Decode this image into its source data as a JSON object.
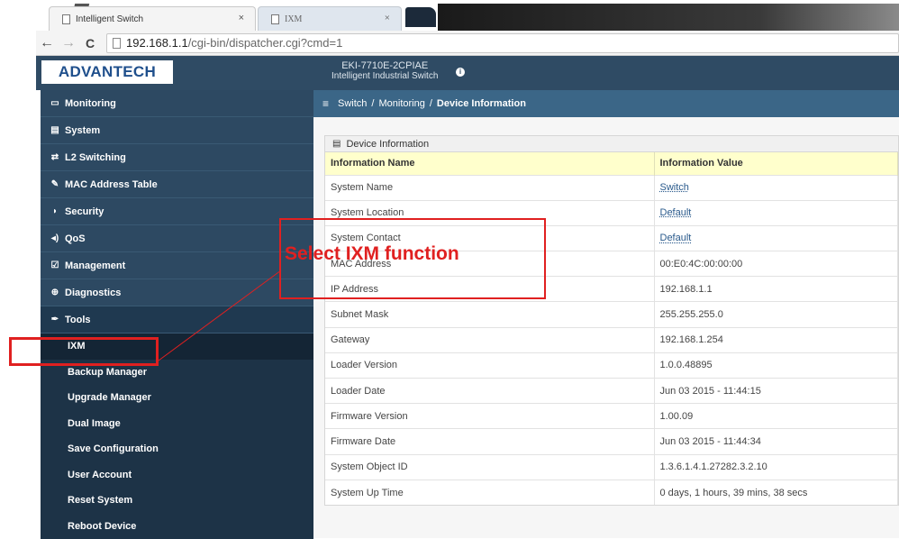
{
  "browser": {
    "tabs": [
      {
        "label": "Intelligent Switch",
        "close": "×"
      },
      {
        "label": "IXM",
        "close": "×"
      }
    ],
    "url_host": "192.168.1.1",
    "url_path": "/cgi-bin/dispatcher.cgi?cmd=1",
    "back": "←",
    "forward": "→",
    "reload": "C"
  },
  "header": {
    "logo": "ADVANTECH",
    "model": "EKI-7710E-2CPIAE",
    "model_sub": "Intelligent Industrial Switch",
    "info": "i"
  },
  "sidebar": {
    "items": [
      {
        "label": "Monitoring",
        "icon": "▭"
      },
      {
        "label": "System",
        "icon": "▤"
      },
      {
        "label": "L2 Switching",
        "icon": "⇄"
      },
      {
        "label": "MAC Address Table",
        "icon": "✎"
      },
      {
        "label": "Security",
        "icon": "◗"
      },
      {
        "label": "QoS",
        "icon": "◂)"
      },
      {
        "label": "Management",
        "icon": "☑"
      },
      {
        "label": "Diagnostics",
        "icon": "⊕"
      },
      {
        "label": "Tools",
        "icon": "✒"
      }
    ],
    "tools_sub": [
      "IXM",
      "Backup Manager",
      "Upgrade Manager",
      "Dual Image",
      "Save Configuration",
      "User Account",
      "Reset System",
      "Reboot Device"
    ]
  },
  "breadcrumb": {
    "menu_icon": "≡",
    "parts": [
      "Switch",
      "Monitoring",
      "Device Information"
    ],
    "sep": "/"
  },
  "panel": {
    "title": "Device Information",
    "icon": "▤",
    "headers": [
      "Information Name",
      "Information Value"
    ],
    "rows": [
      [
        "System Name",
        "Switch"
      ],
      [
        "System Location",
        "Default"
      ],
      [
        "System Contact",
        "Default"
      ],
      [
        "MAC Address",
        "00:E0:4C:00:00:00"
      ],
      [
        "IP Address",
        "192.168.1.1"
      ],
      [
        "Subnet Mask",
        "255.255.255.0"
      ],
      [
        "Gateway",
        "192.168.1.254"
      ],
      [
        "Loader Version",
        "1.0.0.48895"
      ],
      [
        "Loader Date",
        "Jun 03 2015 - 11:44:15"
      ],
      [
        "Firmware Version",
        "1.00.09"
      ],
      [
        "Firmware Date",
        "Jun 03 2015 - 11:44:34"
      ],
      [
        "System Object ID",
        "1.3.6.1.4.1.27282.3.2.10"
      ],
      [
        "System Up Time",
        "0 days, 1 hours, 39 mins, 38 secs"
      ]
    ]
  },
  "annotation": {
    "text": "Select IXM function",
    "color": "#e02020"
  }
}
